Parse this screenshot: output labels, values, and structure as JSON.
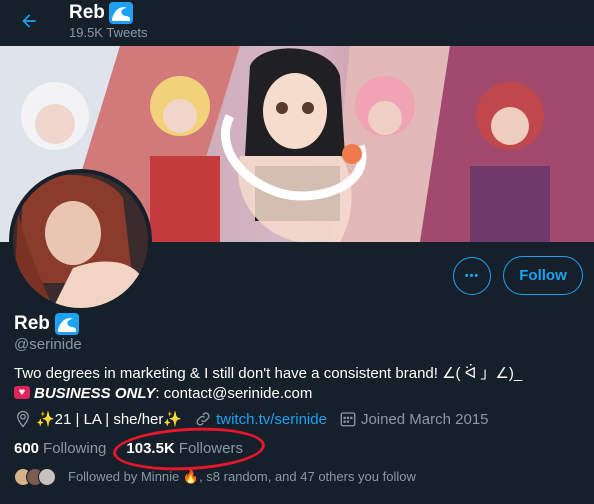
{
  "header": {
    "title": "Reb",
    "tweet_count": "19.5K Tweets"
  },
  "profile": {
    "name": "Reb",
    "handle": "@serinide",
    "bio_line1": "Two degrees in marketing & I still don't have a consistent brand! ∠( ᐛ 」∠)_",
    "bio_business": "BUSINESS ONLY",
    "bio_contact": ": contact@serinide.com",
    "location": "✨21 | LA | she/her✨",
    "website": "twitch.tv/serinide",
    "joined": "Joined March 2015"
  },
  "actions": {
    "more_label": "•••",
    "follow_label": "Follow"
  },
  "stats": {
    "following_count": "600",
    "following_label": "Following",
    "followers_count": "103.5K",
    "followers_label": "Followers"
  },
  "followed_by": "Followed by Minnie 🔥, s8 random, and 47 others you follow",
  "icons": {
    "back": "arrow-left-icon",
    "wave": "wave-emoji-icon",
    "location": "location-pin-icon",
    "link": "link-icon",
    "calendar": "calendar-icon"
  },
  "colors": {
    "background": "#15202b",
    "accent": "#1da1f2",
    "muted": "#8899a6",
    "annotation": "#e8162b"
  }
}
